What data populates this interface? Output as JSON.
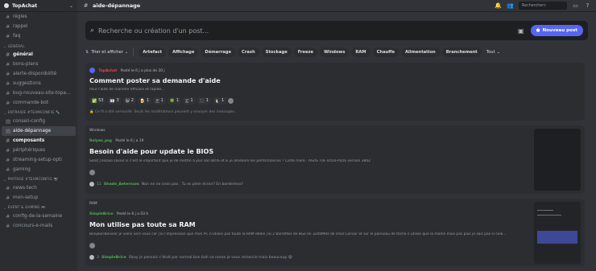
{
  "server": {
    "name": "TopAchat"
  },
  "channels": [
    {
      "label": "règles",
      "type": "text",
      "state": "normal"
    },
    {
      "label": "rappel",
      "type": "text",
      "state": "normal"
    },
    {
      "label": "faq",
      "type": "text",
      "state": "normal"
    },
    {
      "category": "GÉNÉRAL"
    },
    {
      "label": "général",
      "type": "text",
      "state": "bold"
    },
    {
      "label": "bons-plans",
      "type": "text",
      "state": "normal"
    },
    {
      "label": "alerte-disponibilité",
      "type": "text",
      "state": "normal"
    },
    {
      "label": "suggestions",
      "type": "text",
      "state": "normal"
    },
    {
      "label": "bug-nouveau-site-topa...",
      "type": "text",
      "state": "normal"
    },
    {
      "label": "commande-bot",
      "type": "text",
      "state": "normal"
    },
    {
      "category": "ENTRAIDE #TEAMCONFIG 🔧"
    },
    {
      "label": "conseil-config",
      "type": "forum",
      "state": "normal"
    },
    {
      "label": "aide-dépannage",
      "type": "forum",
      "state": "active"
    },
    {
      "label": "composants",
      "type": "text",
      "state": "bold"
    },
    {
      "label": "périphériques",
      "type": "text",
      "state": "normal"
    },
    {
      "label": "streaming-setup-opti",
      "type": "text",
      "state": "normal"
    },
    {
      "label": "gaming",
      "type": "text",
      "state": "normal"
    },
    {
      "category": "PARTAGE #TEAMCONFIG 📷"
    },
    {
      "label": "news-tech",
      "type": "text",
      "state": "normal"
    },
    {
      "label": "mon-setup",
      "type": "text",
      "state": "normal"
    },
    {
      "category": "EVENT & GAMING 🎮"
    },
    {
      "label": "config-de-la-semaine",
      "type": "text",
      "state": "normal"
    },
    {
      "label": "concours-e-mails",
      "type": "text",
      "state": "normal"
    }
  ],
  "topbar": {
    "channel_title": "aide-dépannage",
    "search_placeholder": "Rechercher"
  },
  "composer": {
    "placeholder": "Recherche ou création d'un post...",
    "new_post_label": "Nouveau post"
  },
  "filters": {
    "sort_label": "Trier et afficher",
    "tags": [
      "Artefact",
      "Affichage",
      "Démarrage",
      "Crash",
      "Stockage",
      "Freeze",
      "Windows",
      "RAM",
      "Chauffe",
      "Alimentation",
      "Branchement"
    ],
    "all_label": "Tout"
  },
  "posts": [
    {
      "author": "TopAchat",
      "posted": "Posté le 6 j a plus de 30 j",
      "title": "Comment poster sa demande d'aide",
      "body": "Pour l'aide de manière efficace et rapide...",
      "reactions": [
        {
          "emoji": "✅",
          "count": "53"
        },
        {
          "emoji": "👀",
          "count": "3"
        },
        {
          "emoji": "😺",
          "count": "2"
        },
        {
          "emoji": "🍺",
          "count": "1"
        },
        {
          "emoji": "🇫",
          "count": "1"
        },
        {
          "emoji": "🍀",
          "count": "1"
        },
        {
          "emoji": "🇨",
          "count": "1"
        },
        {
          "emoji": "⬛",
          "count": "1"
        },
        {
          "emoji": "🐧",
          "count": "1"
        }
      ],
      "footer": "Ce fil a été verrouillé. Seuls les modérateurs peuvent y envoyer des messages."
    },
    {
      "tag": "Windows",
      "author": "Relyan_psg",
      "posted": "Posté le 6 j a 19",
      "title": "Besoin d'aide pour update le BIOS",
      "body": "Salut j'essaie savoir si c'est le important que je de mettre à jour son BIOS et si je améliore les performances ? Carte mere : ASUS TUF B550-PLUS version 3802",
      "reply_count": "11",
      "last_author": "Shade_Aeternum",
      "last_msg": "Non ne ne crois pas . Tu es plein écran? En borderless?"
    },
    {
      "tag": "RAM",
      "author": "SimpleBrice",
      "posted": "Posté le 6 j a 03 h",
      "title": "Mon utilise pas toute sa RAM",
      "body": "Bonjour/Bonsoir je viens vers vous car j'ai l'impression que mon PC n'utilise pas toute la RAM dédié j'ai 2 barrettes de 8Go en 3200MHz de chez Corsair et sur le panneau de tâche il utilise que la moitié mais pas plus je sais pas si cela...",
      "reply_count": "3",
      "last_author": "SimpleBrice",
      "last_msg": "Okay je pensais c'était par normal bon bah va nome je vous remercie mais beaucoup 😄"
    }
  ],
  "colors": {
    "accent": "#5865f2",
    "author_green": "#4caf50",
    "author_red": "#ed4245"
  }
}
